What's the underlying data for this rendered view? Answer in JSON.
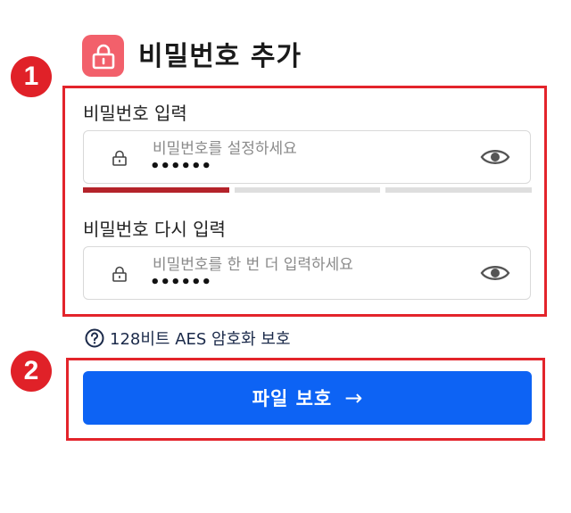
{
  "header": {
    "title": "비밀번호 추가",
    "icon": "lock-icon",
    "icon_color": "#f2606b"
  },
  "annotations": {
    "step1": "1",
    "step2": "2",
    "highlight_color": "#e3242b"
  },
  "password": {
    "label": "비밀번호 입력",
    "placeholder": "비밀번호를 설정하세요",
    "value": "••••••",
    "strength_segments_filled": 1,
    "strength_segments_total": 3
  },
  "confirm": {
    "label": "비밀번호 다시 입력",
    "placeholder": "비밀번호를 한 번 더 입력하세요",
    "value": "••••••"
  },
  "security_note": "128비트 AES 암호화 보호",
  "submit": {
    "label": "파일 보호",
    "arrow": "→",
    "color": "#0d63f4"
  }
}
